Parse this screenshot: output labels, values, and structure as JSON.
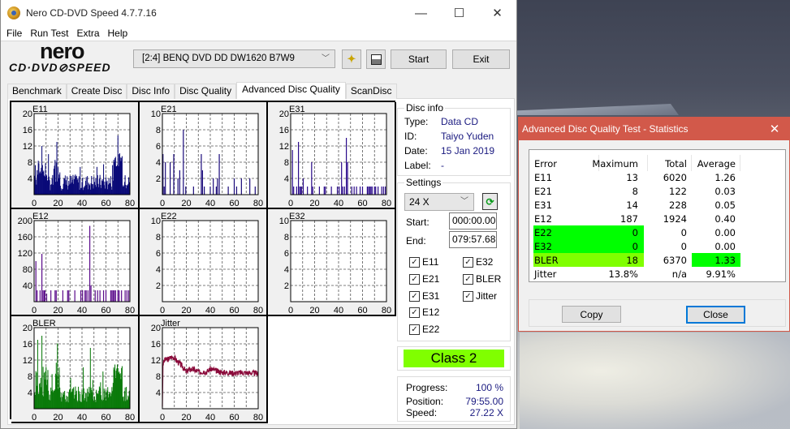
{
  "desktop": {},
  "main_window": {
    "title": "Nero CD-DVD Speed 4.7.7.16",
    "controls": {
      "minimize": "—",
      "maximize": "☐",
      "close": "✕"
    },
    "menu": [
      "File",
      "Run Test",
      "Extra",
      "Help"
    ],
    "logo": {
      "top": "nero",
      "bottom": "CD·DVD⊘SPEED"
    },
    "drive": "[2:4]  BENQ DVD DD DW1620 B7W9",
    "buttons": {
      "start": "Start",
      "exit": "Exit"
    },
    "tabs": [
      "Benchmark",
      "Create Disc",
      "Disc Info",
      "Disc Quality",
      "Advanced Disc Quality",
      "ScanDisc"
    ],
    "active_tab": "Advanced Disc Quality"
  },
  "disc_info": {
    "title": "Disc info",
    "rows": [
      {
        "key": "Type:",
        "value": "Data CD"
      },
      {
        "key": "ID:",
        "value": "Taiyo Yuden"
      },
      {
        "key": "Date:",
        "value": "15 Jan 2019"
      },
      {
        "key": "Label:",
        "value": "-"
      }
    ]
  },
  "settings": {
    "title": "Settings",
    "speed": "24 X",
    "start_label": "Start:",
    "start_value": "000:00.00",
    "end_label": "End:",
    "end_value": "079:57.68",
    "checkboxes": [
      {
        "label": "E11",
        "checked": true
      },
      {
        "label": "E21",
        "checked": true
      },
      {
        "label": "E31",
        "checked": true
      },
      {
        "label": "E12",
        "checked": true
      },
      {
        "label": "E22",
        "checked": true
      },
      {
        "label": "E32",
        "checked": true
      },
      {
        "label": "BLER",
        "checked": true
      },
      {
        "label": "Jitter",
        "checked": true
      }
    ]
  },
  "class_badge": {
    "label": "Class 2",
    "color": "#80ff00"
  },
  "progress": {
    "rows": [
      {
        "key": "Progress:",
        "value": "100 %"
      },
      {
        "key": "Position:",
        "value": "79:55.00"
      },
      {
        "key": "Speed:",
        "value": "27.22 X"
      }
    ]
  },
  "stats_dialog": {
    "title": "Advanced Disc Quality Test - Statistics",
    "close_icon": "✕",
    "headers": [
      "Error",
      "Maximum",
      "Total",
      "Average"
    ],
    "rows": [
      [
        "E11",
        "13",
        "6020",
        "1.26"
      ],
      [
        "E21",
        "8",
        "122",
        "0.03"
      ],
      [
        "E31",
        "14",
        "228",
        "0.05"
      ],
      [
        "E12",
        "187",
        "1924",
        "0.40"
      ],
      [
        "E22",
        "0",
        "0",
        "0.00"
      ],
      [
        "E32",
        "0",
        "0",
        "0.00"
      ],
      [
        "BLER",
        "18",
        "6370",
        "1.33"
      ],
      [
        "Jitter",
        "13.8%",
        "n/a",
        "9.91%"
      ]
    ],
    "highlight_colors": {
      "pass": "#00ff00",
      "warn": "#80ff00"
    },
    "buttons": {
      "copy": "Copy",
      "close": "Close"
    }
  },
  "chart_data": [
    {
      "type": "bar",
      "title": "E11",
      "ylim": [
        0,
        20
      ],
      "yticks": [
        "4",
        "8",
        "12",
        "16",
        "20"
      ],
      "xticks": [
        "0",
        "20",
        "40",
        "60",
        "80"
      ],
      "xlim": [
        0,
        80
      ],
      "color": "#0a0a78",
      "profile": "E11 count per minute; bulk 1-6, peaks ~13 near 19 min, ~12 near 6 min, cluster ~10-11 near 70-72 min",
      "max": 13
    },
    {
      "type": "bar",
      "title": "E21",
      "ylim": [
        0,
        10
      ],
      "yticks": [
        "2",
        "4",
        "6",
        "8",
        "10"
      ],
      "xticks": [
        "0",
        "20",
        "40",
        "60",
        "80"
      ],
      "xlim": [
        0,
        80
      ],
      "color": "#1a0a7a",
      "spikes": [
        [
          0.5,
          5
        ],
        [
          1.5,
          1
        ],
        [
          2.5,
          4
        ],
        [
          6.5,
          4
        ],
        [
          9.5,
          5
        ],
        [
          13,
          2
        ],
        [
          14.5,
          3
        ],
        [
          17.5,
          8
        ],
        [
          19.5,
          1
        ],
        [
          26,
          1
        ],
        [
          32.5,
          5
        ],
        [
          33.5,
          3
        ],
        [
          35,
          1
        ],
        [
          40,
          1
        ],
        [
          42.5,
          2
        ],
        [
          45,
          1
        ],
        [
          46,
          2
        ],
        [
          47.5,
          5
        ],
        [
          55,
          1
        ],
        [
          60,
          2
        ],
        [
          62,
          1
        ],
        [
          66,
          2
        ],
        [
          73,
          2
        ],
        [
          77.5,
          1
        ]
      ],
      "max": 8
    },
    {
      "type": "bar",
      "title": "E31",
      "ylim": [
        0,
        20
      ],
      "yticks": [
        "4",
        "8",
        "12",
        "16",
        "20"
      ],
      "xticks": [
        "0",
        "20",
        "40",
        "60",
        "80"
      ],
      "xlim": [
        0,
        80
      ],
      "color": "#2a0a8a",
      "spikes": [
        [
          1.5,
          11
        ],
        [
          2.5,
          2
        ],
        [
          5,
          2
        ],
        [
          6.5,
          13
        ],
        [
          7.5,
          2
        ],
        [
          8.5,
          2
        ],
        [
          9,
          2
        ],
        [
          10.5,
          4
        ],
        [
          14,
          2
        ],
        [
          17.5,
          8
        ],
        [
          18.5,
          2
        ],
        [
          24,
          2
        ],
        [
          28,
          2
        ],
        [
          29,
          2
        ],
        [
          34,
          2
        ],
        [
          39,
          2
        ],
        [
          40.5,
          2
        ],
        [
          42.5,
          8
        ],
        [
          43.5,
          2
        ],
        [
          45,
          2
        ],
        [
          46.5,
          14
        ],
        [
          47.5,
          8
        ],
        [
          51,
          2
        ],
        [
          53,
          2
        ],
        [
          55,
          2
        ],
        [
          58,
          2
        ],
        [
          60,
          2
        ],
        [
          64,
          2
        ],
        [
          65,
          2
        ],
        [
          66,
          2
        ],
        [
          67,
          2
        ],
        [
          68,
          2
        ],
        [
          70,
          2
        ],
        [
          71,
          2
        ],
        [
          73,
          2
        ],
        [
          76,
          2
        ],
        [
          77.5,
          2
        ],
        [
          79,
          2
        ]
      ],
      "max": 14
    },
    {
      "type": "bar",
      "title": "E12",
      "ylim": [
        0,
        200
      ],
      "yticks": [
        "40",
        "80",
        "120",
        "160",
        "200"
      ],
      "xticks": [
        "0",
        "20",
        "40",
        "60",
        "80"
      ],
      "xlim": [
        0,
        80
      ],
      "color": "#5a0a8a",
      "spikes": [
        [
          1.5,
          100
        ],
        [
          2.5,
          28
        ],
        [
          5,
          28
        ],
        [
          6.5,
          118
        ],
        [
          7.5,
          28
        ],
        [
          8.5,
          28
        ],
        [
          9,
          28
        ],
        [
          10.5,
          20
        ],
        [
          14,
          28
        ],
        [
          17.5,
          28
        ],
        [
          18.5,
          28
        ],
        [
          24,
          28
        ],
        [
          28,
          28
        ],
        [
          29,
          28
        ],
        [
          34,
          28
        ],
        [
          39,
          28
        ],
        [
          40.5,
          28
        ],
        [
          42.5,
          28
        ],
        [
          43.5,
          28
        ],
        [
          45,
          28
        ],
        [
          46.5,
          187
        ],
        [
          47.5,
          40
        ],
        [
          51,
          28
        ],
        [
          53,
          28
        ],
        [
          55,
          28
        ],
        [
          58,
          28
        ],
        [
          60,
          28
        ],
        [
          64,
          28
        ],
        [
          65,
          28
        ],
        [
          66,
          28
        ],
        [
          67,
          28
        ],
        [
          68,
          28
        ],
        [
          70,
          28
        ],
        [
          71,
          28
        ],
        [
          73,
          28
        ],
        [
          76,
          28
        ],
        [
          77.5,
          28
        ],
        [
          79,
          28
        ]
      ],
      "max": 187
    },
    {
      "type": "bar",
      "title": "E22",
      "ylim": [
        0,
        10
      ],
      "yticks": [
        "2",
        "4",
        "6",
        "8",
        "10"
      ],
      "xticks": [
        "0",
        "20",
        "40",
        "60",
        "80"
      ],
      "xlim": [
        0,
        80
      ],
      "spikes": [],
      "max": 0
    },
    {
      "type": "bar",
      "title": "E32",
      "ylim": [
        0,
        10
      ],
      "yticks": [
        "2",
        "4",
        "6",
        "8",
        "10"
      ],
      "xticks": [
        "0",
        "20",
        "40",
        "60",
        "80"
      ],
      "xlim": [
        0,
        80
      ],
      "spikes": [],
      "max": 0
    },
    {
      "type": "bar",
      "title": "BLER",
      "ylim": [
        0,
        20
      ],
      "yticks": [
        "4",
        "8",
        "12",
        "16",
        "20"
      ],
      "xticks": [
        "0",
        "20",
        "40",
        "60",
        "80"
      ],
      "xlim": [
        0,
        80
      ],
      "color": "#0a7a0a",
      "profile": "BLER per minute; bulk 2-8, peaks 17-18 near 3-7 min, ~15 near 47 min, cluster ~10-11 near 70 min",
      "max": 18
    },
    {
      "type": "line",
      "title": "Jitter",
      "ylim": [
        0,
        20
      ],
      "yticks": [
        "4",
        "8",
        "12",
        "16",
        "20"
      ],
      "xticks": [
        "0",
        "20",
        "40",
        "60",
        "80"
      ],
      "xlim": [
        0,
        80
      ],
      "color": "#8a0a3a",
      "points": [
        [
          0,
          0.5
        ],
        [
          0.5,
          11
        ],
        [
          2,
          12
        ],
        [
          5,
          12.3
        ],
        [
          8,
          12.8
        ],
        [
          10,
          12.6
        ],
        [
          12,
          11.8
        ],
        [
          15,
          11
        ],
        [
          18,
          10
        ],
        [
          20,
          9
        ],
        [
          22,
          9.6
        ],
        [
          25,
          9.8
        ],
        [
          28,
          9.4
        ],
        [
          31,
          9
        ],
        [
          34,
          9.2
        ],
        [
          37,
          9.1
        ],
        [
          40,
          9.8
        ],
        [
          43,
          9.6
        ],
        [
          46,
          9.2
        ],
        [
          50,
          9
        ],
        [
          55,
          8.9
        ],
        [
          60,
          8.8
        ],
        [
          65,
          8.9
        ],
        [
          70,
          8.9
        ],
        [
          75,
          8.8
        ],
        [
          80,
          8.8
        ]
      ]
    }
  ]
}
